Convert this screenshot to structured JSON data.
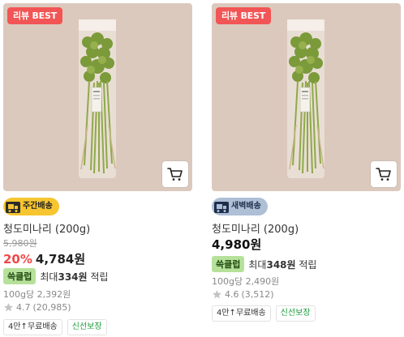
{
  "products": [
    {
      "badge": "리뷰 BEST",
      "delivery_label": "주간배송",
      "title": "청도미나리 (200g)",
      "original_price": "5,980원",
      "discount_rate": "20%",
      "price": "4,784원",
      "reward_badge": "쓱클럽",
      "reward_prefix": "최대",
      "reward_amount": "334원",
      "reward_suffix": "적립",
      "unit_price": "100g당 2,392원",
      "rating": "4.7",
      "review_count": "(20,985)",
      "tags": [
        "4만↑무료배송",
        "신선보장"
      ]
    },
    {
      "badge": "리뷰 BEST",
      "delivery_label": "새벽배송",
      "title": "청도미나리 (200g)",
      "price": "4,980원",
      "reward_badge": "쓱클럽",
      "reward_prefix": "최대",
      "reward_amount": "348원",
      "reward_suffix": "적립",
      "unit_price": "100g당 2,490원",
      "rating": "4.6",
      "review_count": "(3,512)",
      "tags": [
        "4만↑무료배송",
        "신선보장"
      ]
    }
  ],
  "icons": {
    "cart": "shopping-cart-icon",
    "star": "star-icon",
    "truck": "delivery-truck-icon"
  },
  "colors": {
    "best_badge": "#f25555",
    "discount": "#f04848",
    "weekday_delivery": "#f6c52f",
    "dawn_delivery": "#aebfd6",
    "reward_badge": "#b6e19a",
    "fresh_tag": "#1c9c3a",
    "thumb_background": "#dcc9bd"
  }
}
